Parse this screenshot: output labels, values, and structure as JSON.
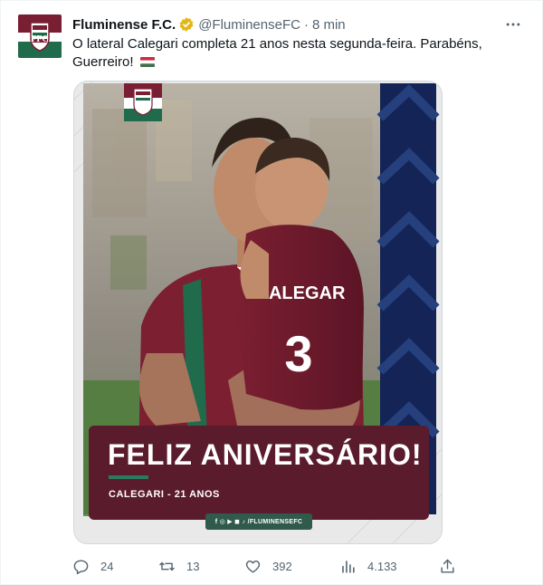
{
  "tweet": {
    "author_name": "Fluminense F.C.",
    "author_handle": "@FluminenseFC",
    "separator": "·",
    "time": "8 min",
    "more_icon": "more-icon",
    "text": "O lateral Calegari completa 21 anos nesta segunda-feira. Parabéns, Guerreiro!",
    "emoji": "hungary-flag"
  },
  "media": {
    "caption_title": "FELIZ ANIVERSÁRIO!",
    "caption_sub": "CALEGARI - 21 ANOS",
    "social_tag": "f ◎ ▶ ◼ ♪ /FLUMINENSEFC",
    "shirt_name": "CALEGARI",
    "shirt_number": "3"
  },
  "actions": {
    "reply_count": "24",
    "retweet_count": "13",
    "like_count": "392",
    "views_count": "4.133"
  },
  "colors": {
    "maroon": "#7a1e33",
    "green": "#1f6b4c",
    "link_gray": "#536471",
    "verified_gold": "#e2b719"
  }
}
